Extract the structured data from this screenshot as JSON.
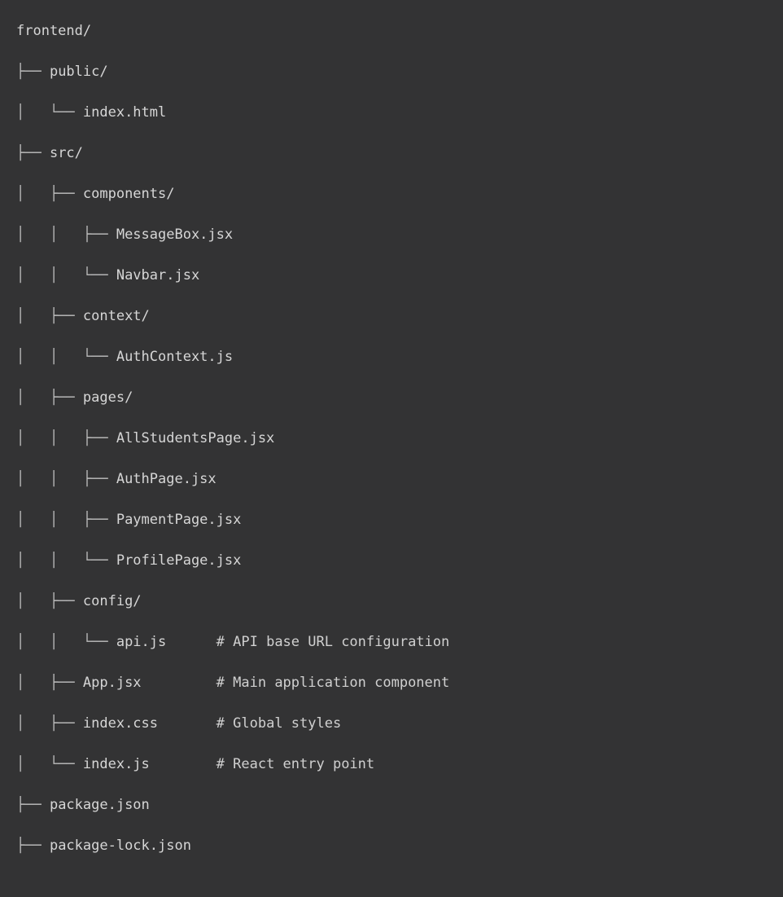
{
  "code_block": {
    "lines": [
      {
        "guide": "",
        "name": "frontend/",
        "pad": "",
        "comment": ""
      },
      {
        "guide": "├── ",
        "name": "public/",
        "pad": "",
        "comment": ""
      },
      {
        "guide": "│   └── ",
        "name": "index.html",
        "pad": "",
        "comment": ""
      },
      {
        "guide": "├── ",
        "name": "src/",
        "pad": "",
        "comment": ""
      },
      {
        "guide": "│   ├── ",
        "name": "components/",
        "pad": "",
        "comment": ""
      },
      {
        "guide": "│   │   ├── ",
        "name": "MessageBox.jsx",
        "pad": "",
        "comment": ""
      },
      {
        "guide": "│   │   └── ",
        "name": "Navbar.jsx",
        "pad": "",
        "comment": ""
      },
      {
        "guide": "│   ├── ",
        "name": "context/",
        "pad": "",
        "comment": ""
      },
      {
        "guide": "│   │   └── ",
        "name": "AuthContext.js",
        "pad": "",
        "comment": ""
      },
      {
        "guide": "│   ├── ",
        "name": "pages/",
        "pad": "",
        "comment": ""
      },
      {
        "guide": "│   │   ├── ",
        "name": "AllStudentsPage.jsx",
        "pad": "",
        "comment": ""
      },
      {
        "guide": "│   │   ├── ",
        "name": "AuthPage.jsx",
        "pad": "",
        "comment": ""
      },
      {
        "guide": "│   │   ├── ",
        "name": "PaymentPage.jsx",
        "pad": "",
        "comment": ""
      },
      {
        "guide": "│   │   └── ",
        "name": "ProfilePage.jsx",
        "pad": "",
        "comment": ""
      },
      {
        "guide": "│   ├── ",
        "name": "config/",
        "pad": "",
        "comment": ""
      },
      {
        "guide": "│   │   └── ",
        "name": "api.js",
        "pad": "      ",
        "comment": "# API base URL configuration"
      },
      {
        "guide": "│   ├── ",
        "name": "App.jsx",
        "pad": "         ",
        "comment": "# Main application component"
      },
      {
        "guide": "│   ├── ",
        "name": "index.css",
        "pad": "       ",
        "comment": "# Global styles"
      },
      {
        "guide": "│   └── ",
        "name": "index.js",
        "pad": "        ",
        "comment": "# React entry point"
      },
      {
        "guide": "├── ",
        "name": "package.json",
        "pad": "",
        "comment": ""
      },
      {
        "guide": "├── ",
        "name": "package-lock.json",
        "pad": "",
        "comment": ""
      }
    ]
  }
}
